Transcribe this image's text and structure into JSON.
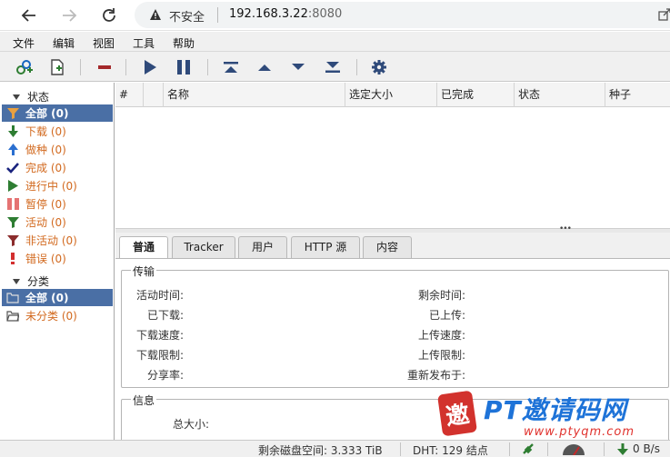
{
  "browser": {
    "insecure_label": "不安全",
    "url_host": "192.168.3.22",
    "url_port": ":8080"
  },
  "menu": [
    "文件",
    "编辑",
    "视图",
    "工具",
    "帮助"
  ],
  "toolbar": {
    "icons": [
      "add-torrent-link-icon",
      "add-torrent-file-icon",
      "delete-icon",
      "resume-icon",
      "pause-icon",
      "move-top-icon",
      "move-up-icon",
      "move-down-icon",
      "move-bottom-icon",
      "options-gear-icon"
    ]
  },
  "sidebar": {
    "status_header": "状态",
    "status_items": [
      {
        "label": "全部 (0)",
        "icon": "filter-icon"
      },
      {
        "label": "下载 (0)",
        "icon": "download-arrow-icon"
      },
      {
        "label": "做种 (0)",
        "icon": "upload-arrow-icon"
      },
      {
        "label": "完成 (0)",
        "icon": "checkmark-icon"
      },
      {
        "label": "进行中 (0)",
        "icon": "play-icon"
      },
      {
        "label": "暂停 (0)",
        "icon": "pause-bars-icon"
      },
      {
        "label": "活动 (0)",
        "icon": "filter-green-icon"
      },
      {
        "label": "非活动 (0)",
        "icon": "filter-red-icon"
      },
      {
        "label": "错误 (0)",
        "icon": "error-exclamation-icon"
      }
    ],
    "category_header": "分类",
    "category_items": [
      {
        "label": "全部 (0)",
        "icon": "folder-open-icon"
      },
      {
        "label": "未分类 (0)",
        "icon": "folder-open-icon"
      }
    ]
  },
  "table": {
    "columns": [
      "#",
      "",
      "名称",
      "选定大小",
      "已完成",
      "状态",
      "种子"
    ]
  },
  "details": {
    "tabs": [
      "普通",
      "Tracker",
      "用户",
      "HTTP 源",
      "内容"
    ],
    "transfer_legend": "传输",
    "left_fields": [
      "活动时间:",
      "已下载:",
      "下载速度:",
      "下载限制:",
      "分享率:"
    ],
    "right_fields": [
      "剩余时间:",
      "已上传:",
      "上传速度:",
      "上传限制:",
      "重新发布于:"
    ],
    "info_legend": "信息",
    "info_fields": [
      "总大小:"
    ]
  },
  "statusbar": {
    "free_space": "剩余磁盘空间: 3.333 TiB",
    "dht": "DHT: 129 结点",
    "speed": "0 B/s"
  },
  "watermark": {
    "badge": "邀",
    "title": "PT邀请码网",
    "url": "www.ptyqm.com"
  },
  "colors": {
    "selected_bg": "#4a6fa5",
    "item_text": "#d2691e"
  }
}
